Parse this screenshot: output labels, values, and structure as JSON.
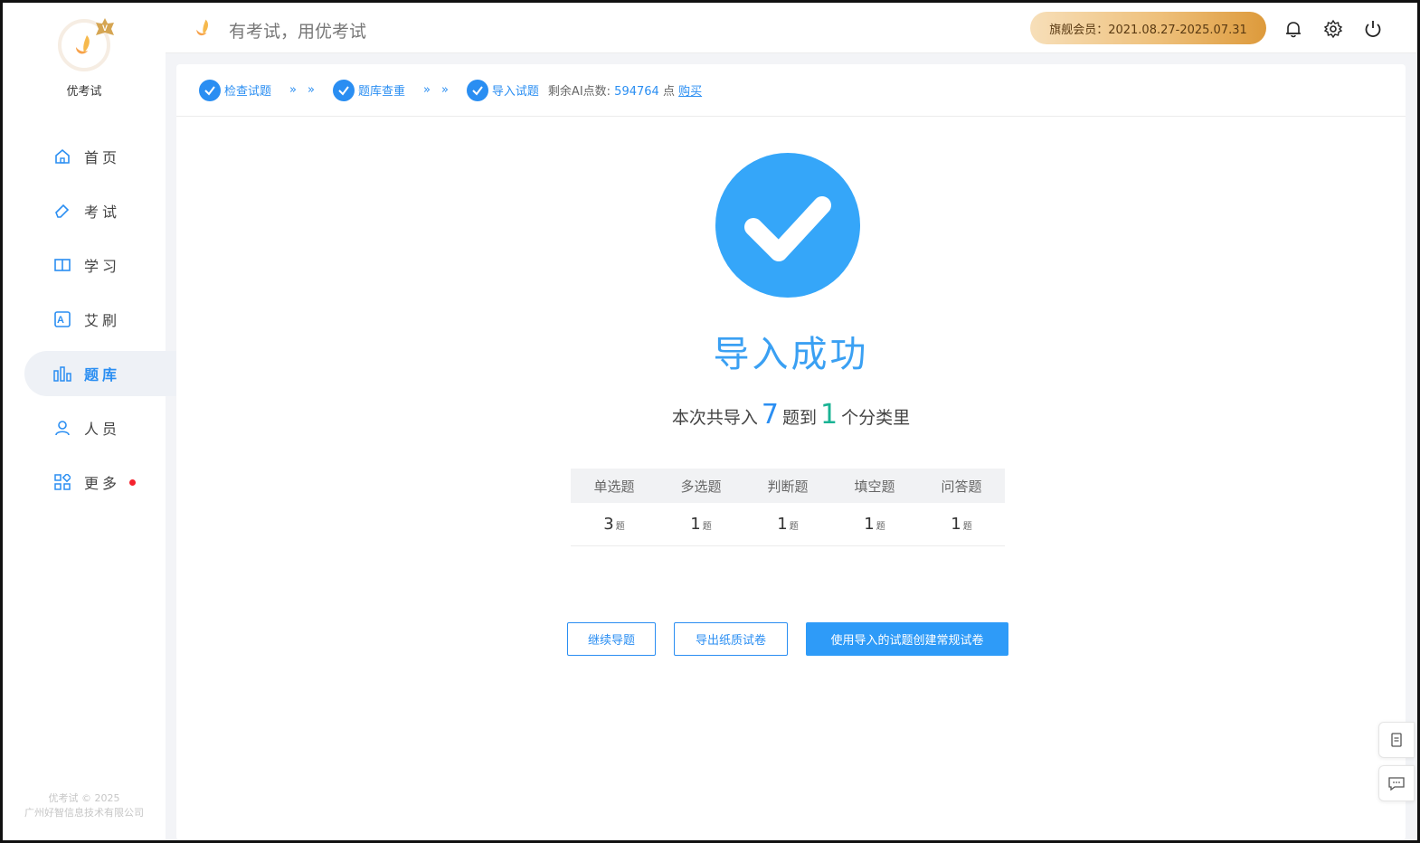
{
  "brand": {
    "name": "优考试",
    "slogan": "有考试，用优考试"
  },
  "sidebar": {
    "items": [
      {
        "label": "首页",
        "icon": "home-icon"
      },
      {
        "label": "考试",
        "icon": "eraser-icon"
      },
      {
        "label": "学习",
        "icon": "book-icon"
      },
      {
        "label": "艾刷",
        "icon": "letter-a-icon"
      },
      {
        "label": "题库",
        "icon": "bar-chart-icon",
        "active": true
      },
      {
        "label": "人员",
        "icon": "user-icon"
      },
      {
        "label": "更多",
        "icon": "apps-icon",
        "has_dot": true
      }
    ],
    "copyright_1": "优考试 © 2025",
    "copyright_2": "广州好智信息技术有限公司"
  },
  "topbar": {
    "member_label": "旗舰会员：2021.08.27-2025.07.31"
  },
  "steps": {
    "step1": "检查试题",
    "step2": "题库查重",
    "step3": "导入试题",
    "arrow": "»",
    "points_label": "剩余AI点数:",
    "points_value": "594764",
    "points_unit": "点",
    "buy_label": "购买"
  },
  "result": {
    "title": "导入成功",
    "summary_prefix": "本次共导入",
    "question_count": "7",
    "summary_mid": "题到",
    "category_count": "1",
    "summary_suffix": "个分类里"
  },
  "table": {
    "headers": [
      "单选题",
      "多选题",
      "判断题",
      "填空题",
      "问答题"
    ],
    "counts": [
      "3",
      "1",
      "1",
      "1",
      "1"
    ],
    "unit": "题"
  },
  "buttons": {
    "continue": "继续导题",
    "export": "导出纸质试卷",
    "create": "使用导入的试题创建常规试卷"
  },
  "colors": {
    "accent": "#2a8ef2",
    "success": "#35a6f9",
    "teal": "#1ab394"
  }
}
